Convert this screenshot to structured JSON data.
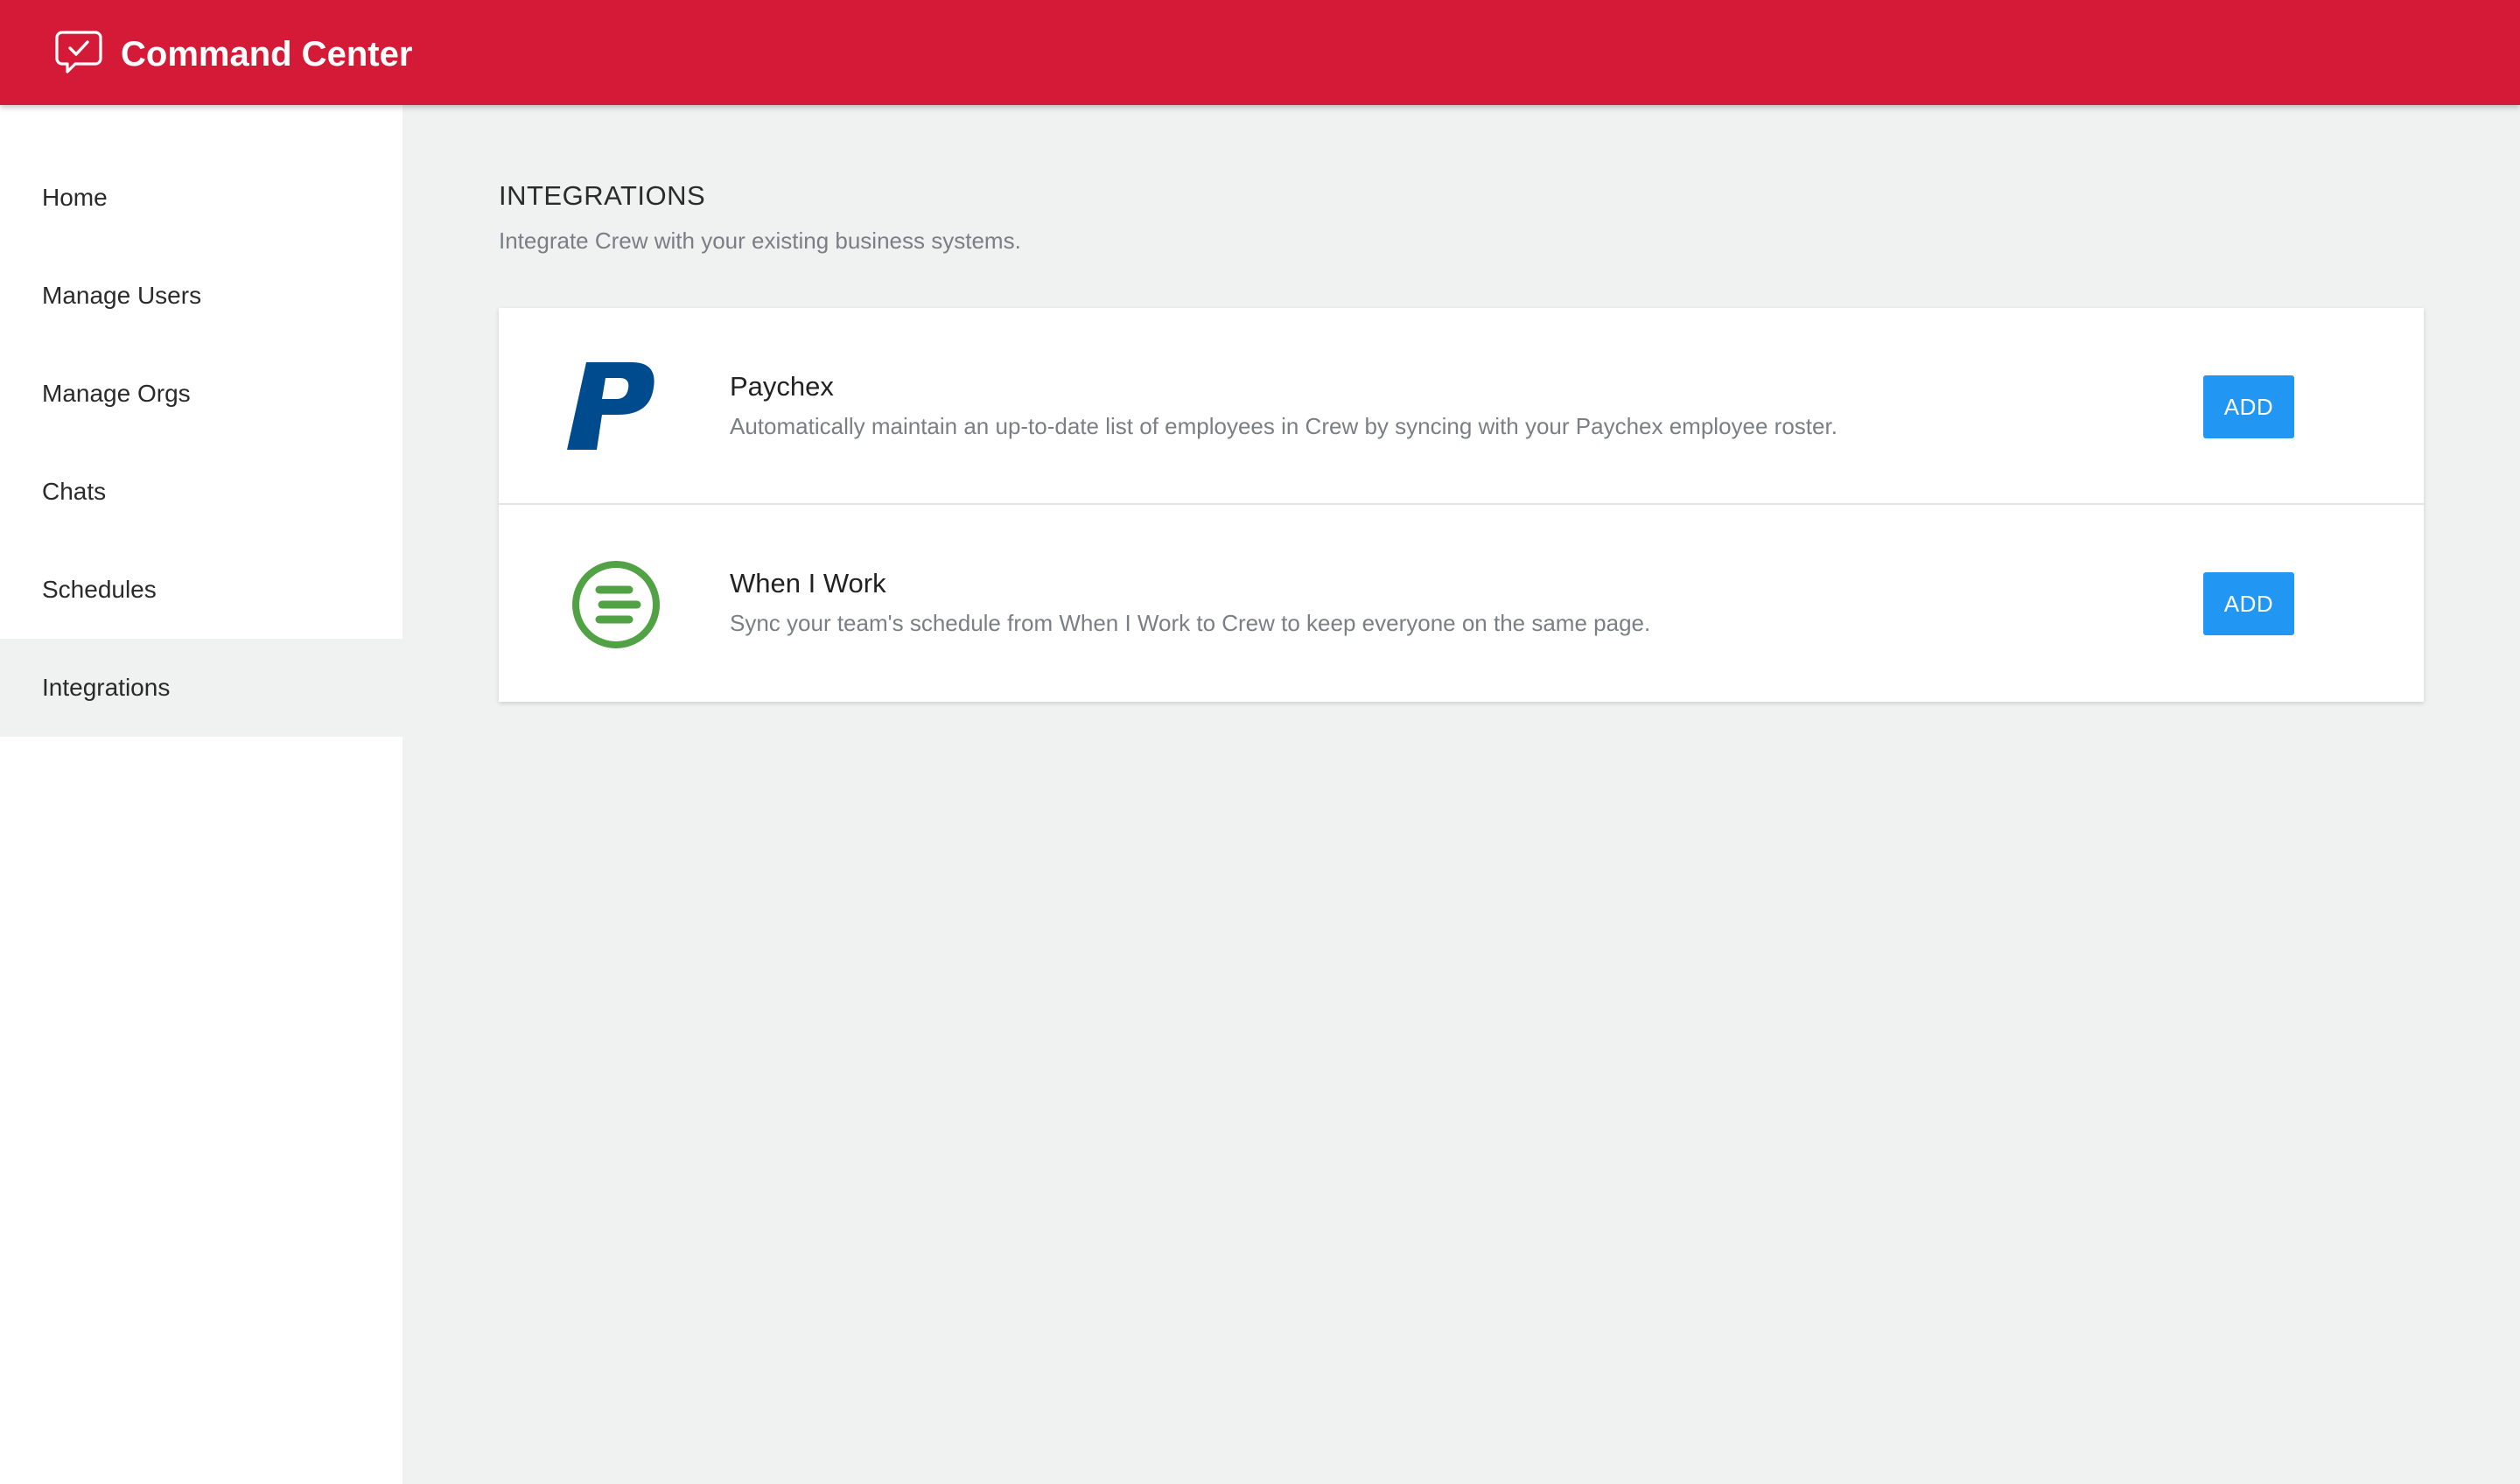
{
  "header": {
    "title": "Command Center",
    "icon": "chat-check-icon",
    "background_color": "#d51a38"
  },
  "sidebar": {
    "items": [
      {
        "label": "Home",
        "active": false
      },
      {
        "label": "Manage Users",
        "active": false
      },
      {
        "label": "Manage Orgs",
        "active": false
      },
      {
        "label": "Chats",
        "active": false
      },
      {
        "label": "Schedules",
        "active": false
      },
      {
        "label": "Integrations",
        "active": true
      }
    ]
  },
  "main": {
    "title": "INTEGRATIONS",
    "subtitle": "Integrate Crew with your existing business systems.",
    "integrations": [
      {
        "name": "Paychex",
        "description": "Automatically maintain an up-to-date list of employees in Crew by syncing with your Paychex employee roster.",
        "button_label": "ADD",
        "logo": "paychex-logo-icon",
        "logo_color": "#004b8d"
      },
      {
        "name": "When I Work",
        "description": "Sync your team's schedule from When I Work to Crew to keep everyone on the same page.",
        "button_label": "ADD",
        "logo": "when-i-work-logo-icon",
        "logo_color": "#51a145"
      }
    ]
  },
  "colors": {
    "accent_button": "#2196f3",
    "page_background": "#f0f1f1"
  }
}
